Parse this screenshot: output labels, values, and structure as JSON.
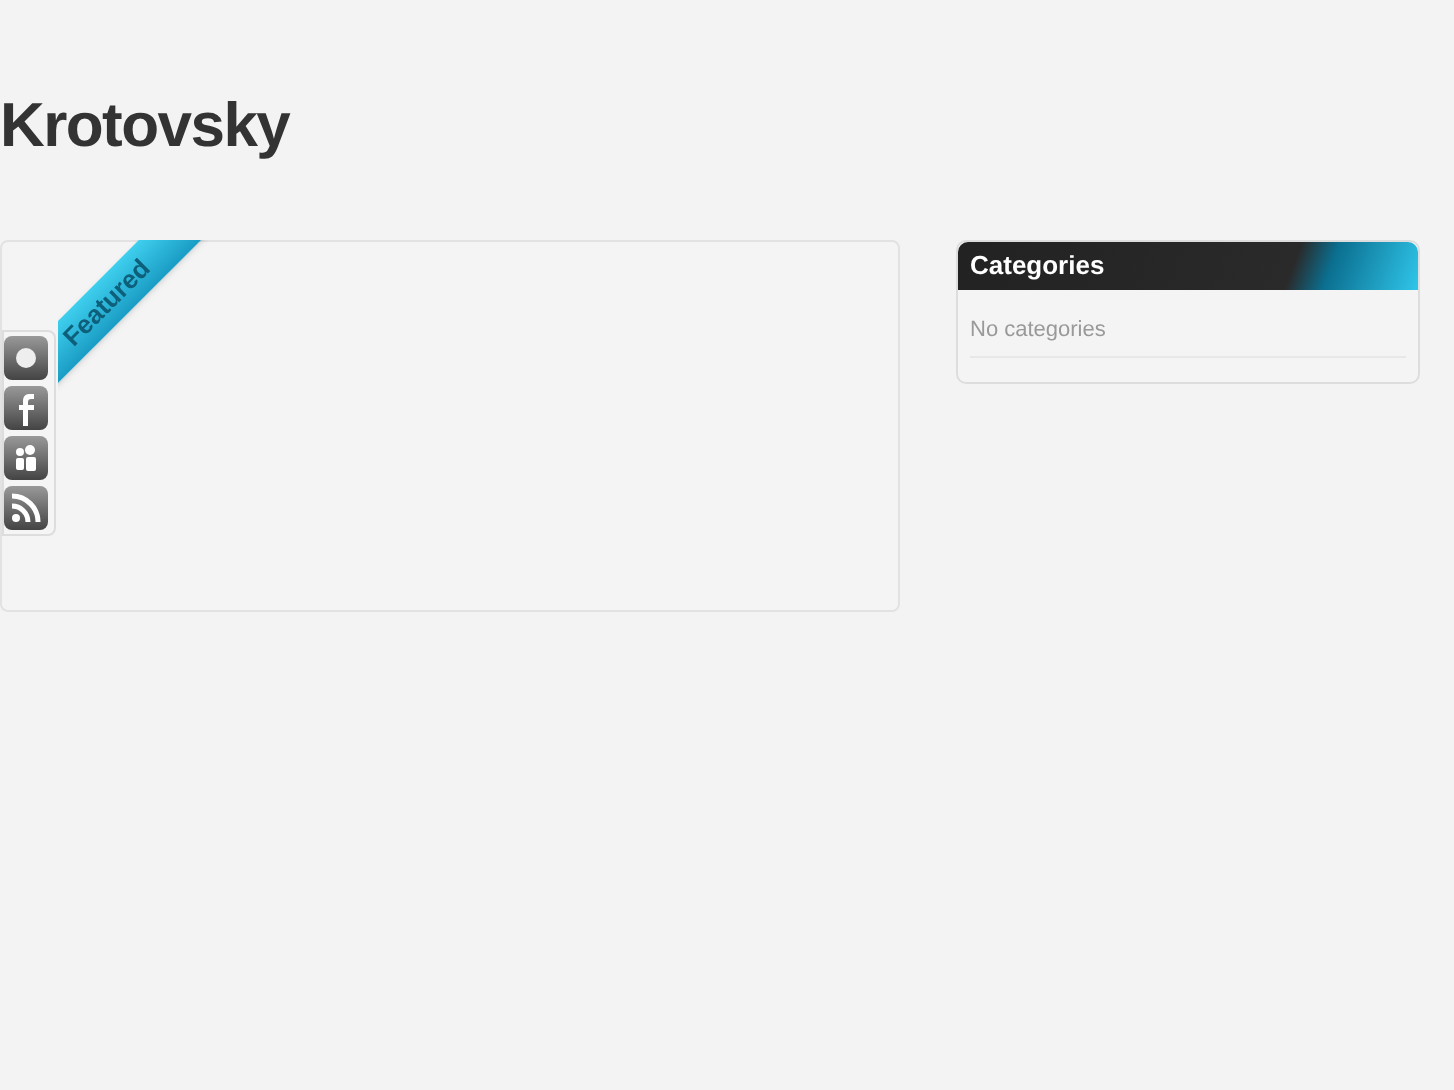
{
  "site_title": "Krotovsky",
  "featured_ribbon": "Featured",
  "share_icons": [
    {
      "kind": "generic"
    },
    {
      "kind": "facebook"
    },
    {
      "kind": "myspace"
    },
    {
      "kind": "rss"
    }
  ],
  "sidebar": {
    "title": "Categories",
    "empty_text": "No categories"
  }
}
